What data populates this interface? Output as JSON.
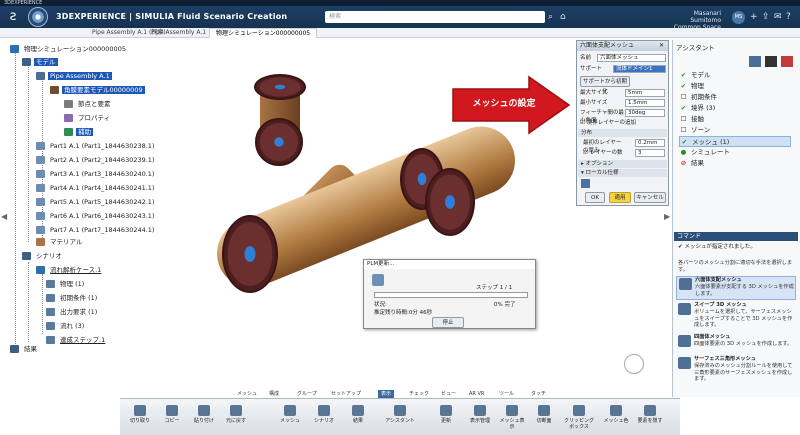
{
  "app": {
    "window_title": "3DEXPERIENCE",
    "brand": "3DEXPERIENCE | SIMULIA Fluid Scenario Creation",
    "search_placeholder": "検索",
    "user_line1": "Masanari Sumitomo",
    "user_line2": "Common Space",
    "avatar": "MS"
  },
  "tabs": [
    {
      "label": "Pipe Assembly A.1 (探索)"
    },
    {
      "label": "Pipe Assembly A.1"
    },
    {
      "label": "物理シミュレーション000000005"
    }
  ],
  "tree": {
    "root": "物理シミュレーション000000005",
    "model": "モデル",
    "assembly": "Pipe Assembly A.1",
    "fluid_model": "角膜要素モデル00000009",
    "points": "節点と要素",
    "property": "プロパティ",
    "mesh": "補助",
    "parts": [
      "Part1 A.1 (Part1_1844630238.1)",
      "Part2 A.1 (Part2_1844630239.1)",
      "Part3 A.1 (Part3_1844630240.1)",
      "Part4 A.1 (Part4_1844630241.1)",
      "Part5 A.1 (Part5_1844630242.1)",
      "Part6 A.1 (Part6_1844630243.1)",
      "Part7 A.1 (Part7_1844630244.1)"
    ],
    "material": "マテリアル",
    "scenario": "シナリオ",
    "case": "流れ解析ケース.1",
    "case_items": [
      "物理 (1)",
      "初期条件 (1)",
      "出力要求 (1)",
      "流れ (3)"
    ],
    "step": "連成ステップ.1",
    "results": "結果"
  },
  "mesh_panel": {
    "title": "六面体支配メッシュ",
    "name_label": "名前",
    "name_value": "六面体メッシュ",
    "support_label": "サポート",
    "support_value": "流体ドメイン1",
    "init_button": "サポートから初期化",
    "max_size_label": "最大サイズ",
    "max_size_value": "5mm",
    "min_size_label": "最小サイズ",
    "min_size_value": "1.5mm",
    "angle_label": "フィーチャ間の最小角度",
    "angle_value": "30deg",
    "boundary_layer": "境界レイヤーの追加",
    "distribution": "分布",
    "first_layer_label": "最初のレイヤーの厚み",
    "first_layer_value": "0.2mm",
    "layer_count_label": "レイヤーの数",
    "layer_count_value": "3",
    "options": "オプション",
    "local_spec": "ローカル仕様",
    "ok": "OK",
    "apply": "適用",
    "cancel": "キャンセル"
  },
  "callout": {
    "label": "メッシュの設定",
    "color": "#d0181e"
  },
  "assistant": {
    "title": "アシスタント",
    "items": [
      {
        "label": "モデル",
        "mark": "✔"
      },
      {
        "label": "物理",
        "mark": "✔"
      },
      {
        "label": "初期条件",
        "mark": "☐"
      },
      {
        "label": "境界 (3)",
        "mark": "✔"
      },
      {
        "label": "接触",
        "mark": "☐"
      },
      {
        "label": "ゾーン",
        "mark": "☐"
      },
      {
        "label": "メッシュ (1)",
        "mark": "✔"
      },
      {
        "label": "シミュレート",
        "mark": "●"
      },
      {
        "label": "結果",
        "mark": "⊘"
      }
    ]
  },
  "commands": {
    "title": "コマンド",
    "status": "メッシュが指定されました。",
    "hint": "各パーツのメッシュ分割に適切な手法を選択します。",
    "items": [
      {
        "title": "六面体支配メッシュ",
        "desc": "六面体要素が支配する 3D メッシュを作成します。"
      },
      {
        "title": "スイープ 3D メッシュ",
        "desc": "ボリュームを選択して、サーフェスメッシュをスイープすることで 3D メッシュを作成します。"
      },
      {
        "title": "四面体メッシュ",
        "desc": "四面体要素の 3D メッシュを作成します。"
      },
      {
        "title": "サーフェス三角形メッシュ",
        "desc": "保存済みのメッシュ分割ルールを使用して三角形要素のサーフェスメッシュを作成します。"
      }
    ]
  },
  "plm_dialog": {
    "title": "PLM更新...",
    "step": "ステップ 1 / 1",
    "status_label": "状況:",
    "percent": "0% 完了",
    "remaining": "推定残り時間:0分 46秒",
    "stop": "停止",
    "progress": 0
  },
  "bottom_tabs": [
    "メッシュ",
    "構成",
    "グループ",
    "セットアップ",
    "表示",
    "チェック",
    "ビュー",
    "AR VR",
    "ツール",
    "タッチ"
  ],
  "active_bottom_tab": "表示",
  "bottom_tools": [
    "切り取り",
    "コピー",
    "貼り付け",
    "元に戻す",
    "メッシュ",
    "シナリオ",
    "結果",
    "アシスタント",
    "更新",
    "表示管理",
    "メッシュ表示",
    "切断面",
    "クリッピングボックス",
    "メッシュ色",
    "要素を隠す"
  ]
}
